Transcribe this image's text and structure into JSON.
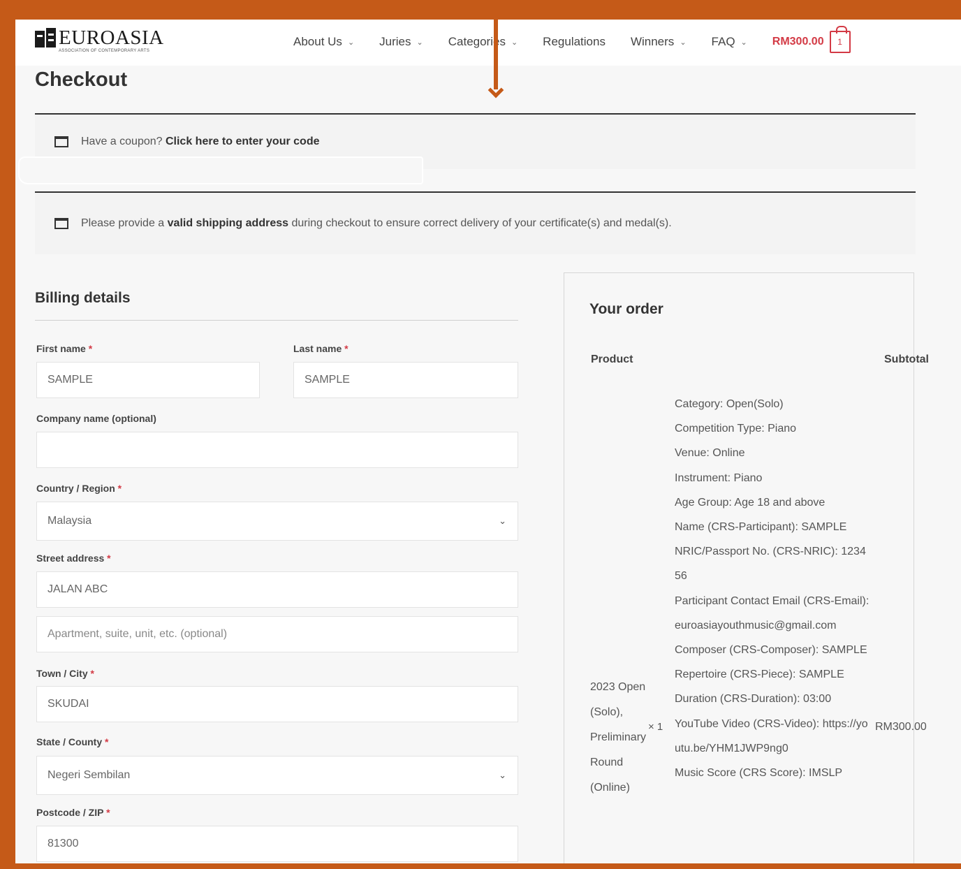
{
  "brand": {
    "name": "EUROASIA",
    "tagline": "ASSOCIATION OF CONTEMPORARY ARTS"
  },
  "nav": {
    "items": [
      {
        "label": "About Us"
      },
      {
        "label": "Juries"
      },
      {
        "label": "Categories"
      },
      {
        "label": "Regulations"
      },
      {
        "label": "Winners"
      },
      {
        "label": "FAQ"
      }
    ],
    "cart_total": "RM300.00",
    "cart_count": "1"
  },
  "page": {
    "title": "Checkout"
  },
  "notices": {
    "coupon_text": "Have a coupon?",
    "coupon_link": "Click here to enter your code",
    "shipping_prefix": "Please provide a",
    "shipping_bold": "valid shipping address",
    "shipping_suffix": "during checkout to ensure correct delivery of your certificate(s) and medal(s)."
  },
  "billing": {
    "title": "Billing details",
    "first_name_label": "First name",
    "first_name_value": "SAMPLE",
    "last_name_label": "Last name",
    "last_name_value": "SAMPLE",
    "company_label": "Company name (optional)",
    "company_value": "",
    "country_label": "Country / Region",
    "country_value": "Malaysia",
    "street_label": "Street address",
    "street_value": "JALAN ABC",
    "apartment_placeholder": "Apartment, suite, unit, etc. (optional)",
    "city_label": "Town / City",
    "city_value": "SKUDAI",
    "state_label": "State / County",
    "state_value": "Negeri Sembilan",
    "postcode_label": "Postcode / ZIP",
    "postcode_value": "81300",
    "required_mark": "*"
  },
  "order": {
    "title": "Your order",
    "col_product": "Product",
    "col_subtotal": "Subtotal",
    "product_name": "2023 Open (Solo), Preliminary Round (Online)",
    "quantity": "× 1",
    "price": "RM300.00",
    "meta": [
      "Category: Open(Solo)",
      "Competition Type: Piano",
      "Venue: Online",
      "Instrument: Piano",
      "Age Group: Age 18 and above",
      "Name (CRS-Participant): SAMPLE",
      "NRIC/Passport No. (CRS-NRIC): 123456",
      "Participant Contact Email (CRS-Email): euroasiayouthmusic@gmail.com",
      "Composer (CRS-Composer): SAMPLE",
      "Repertoire (CRS-Piece): SAMPLE",
      "Duration (CRS-Duration): 03:00",
      "YouTube Video (CRS-Video): https://youtu.be/YHM1JWP9ng0",
      "Music Score (CRS Score): IMSLP"
    ]
  },
  "colors": {
    "frame": "#c55a18",
    "accent": "#d33a45",
    "text": "#333333"
  }
}
